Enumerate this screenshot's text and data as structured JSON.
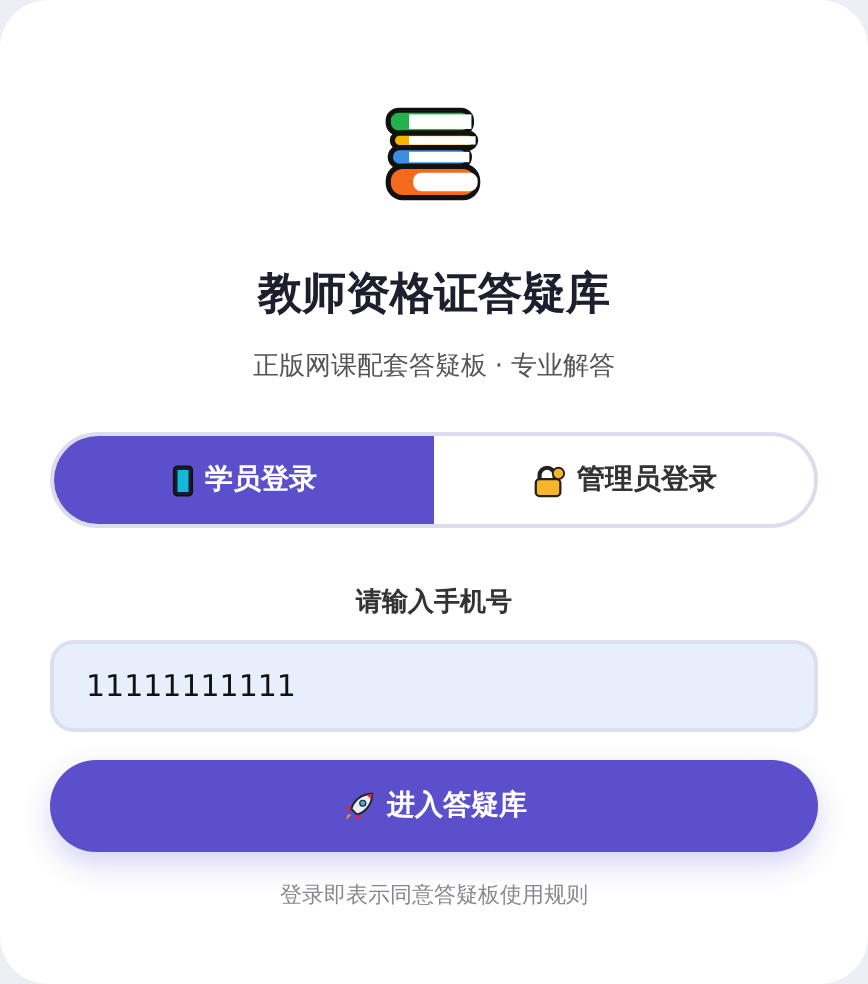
{
  "title": "教师资格证答疑库",
  "subtitle": "正版网课配套答疑板 · 专业解答",
  "tabs": [
    {
      "label": "学员登录",
      "kind": "phone",
      "selected": true
    },
    {
      "label": "管理员登录",
      "kind": "lock",
      "selected": false
    }
  ],
  "phone_field": {
    "label": "请输入手机号",
    "value": "11111111111"
  },
  "submit_button": {
    "label": "进入答疑库"
  },
  "footer": "登录即表示同意答疑板使用规则"
}
